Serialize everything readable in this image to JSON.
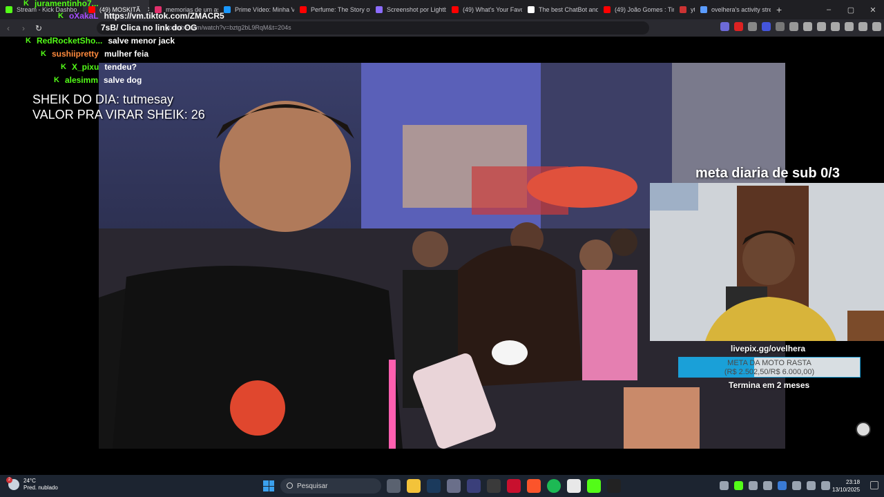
{
  "browser": {
    "tabs": [
      {
        "label": "Stream - Kick Dashbo",
        "favicon_color": "#53fc18",
        "active": false,
        "closable": false
      },
      {
        "label": "(49) MOSKITÃ",
        "favicon_color": "#ff0000",
        "active": true,
        "closable": true
      },
      {
        "label": "memorias de um assa",
        "favicon_color": "#e1306c",
        "active": false,
        "closable": false
      },
      {
        "label": "Prime Vídeo: Minha V",
        "favicon_color": "#1a98ff",
        "active": false,
        "closable": false
      },
      {
        "label": "Perfume: The Story of",
        "favicon_color": "#ff0000",
        "active": false,
        "closable": false
      },
      {
        "label": "Screenshot por Lightb",
        "favicon_color": "#8c6cff",
        "active": false,
        "closable": false
      },
      {
        "label": "(49) What's Your Favo",
        "favicon_color": "#ff0000",
        "active": false,
        "closable": false
      },
      {
        "label": "The best ChatBot and",
        "favicon_color": "#ffffff",
        "active": false,
        "closable": false
      },
      {
        "label": "(49) João Gomes : Tirp",
        "favicon_color": "#ff0000",
        "active": false,
        "closable": false
      },
      {
        "label": "ytb",
        "favicon_color": "#cc3333",
        "active": false,
        "closable": false
      },
      {
        "label": "ovelhera's activity stre",
        "favicon_color": "#5b9cff",
        "active": false,
        "closable": false
      }
    ],
    "new_tab_icon": "+",
    "window_controls": [
      "–",
      "▢",
      "✕"
    ],
    "url": "youtube.com/watch?v=bztg2bL9RqM&t=204s"
  },
  "chat": [
    {
      "user": "juramentinho7...",
      "user_color": "#53fc18",
      "message": ""
    },
    {
      "user": "oXakaL",
      "user_color": "#a64dff",
      "message": "https://vm.tiktok.com/ZMACR5"
    },
    {
      "user": "",
      "user_color": "#53fc18",
      "message": "7sB/ Clica no link do OG"
    },
    {
      "user": "RedRocketSho...",
      "user_color": "#53fc18",
      "message": "salve menor jack"
    },
    {
      "user": "sushiipretty",
      "user_color": "#ff8a3d",
      "message": "mulher feia"
    },
    {
      "user": "X_pixu",
      "user_color": "#53fc18",
      "message": "tendeu?"
    },
    {
      "user": "alesimm",
      "user_color": "#53fc18",
      "message": "salve dog"
    }
  ],
  "overlay": {
    "sheik_line1": "SHEIK DO DIA: tutmesay",
    "sheik_line2": "VALOR PRA VIRAR SHEIK: 26",
    "meta_sub": "meta diaria de sub 0/3",
    "livepix": "livepix.gg/ovelhera",
    "goal_title": "META DA MOTO RASTA",
    "goal_amount": "(R$ 2.502,50/R$ 6.000,00)",
    "goal_progress": 0.417,
    "goal_end": "Termina em 2 meses"
  },
  "taskbar": {
    "temperature": "24°C",
    "weather": "Pred. nublado",
    "weather_badge": "2",
    "search_placeholder": "Pesquisar",
    "time": "23:18",
    "date": "13/10/2025"
  }
}
